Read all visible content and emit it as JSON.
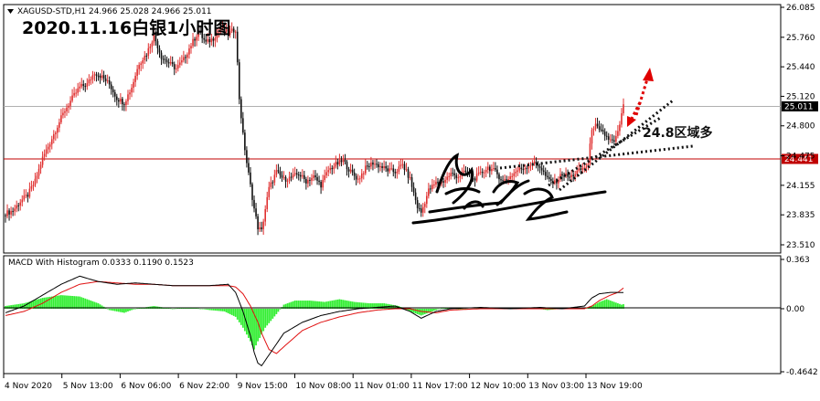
{
  "header": {
    "symbol_line": "XAGUSD-STD,H1  24.966 25.028 24.966 25.011",
    "headline": "2020.11.16白银1小时图"
  },
  "annotation": {
    "zone_text": "24.8区域多"
  },
  "indicator": {
    "label": "MACD With Histogram 0.0333 0.1190 0.1523"
  },
  "colors": {
    "bull_candle": "#e03030",
    "bear_candle": "#101010",
    "histogram": "#33ee33",
    "macd_line": "#000000",
    "signal_line": "#e01010",
    "hline": "#c00000",
    "price_tag_bg": "#c00000",
    "arrow": "#e00000"
  },
  "chart_data": [
    {
      "type": "candlestick",
      "title": "XAGUSD-STD,H1",
      "ylim": [
        23.51,
        26.085
      ],
      "y_ticks": [
        "26.085",
        "25.760",
        "25.440",
        "25.120",
        "24.800",
        "24.475",
        "24.155",
        "23.835",
        "23.510"
      ],
      "x_ticks": [
        "4 Nov 2020",
        "5 Nov 13:00",
        "6 Nov 06:00",
        "6 Nov 22:00",
        "9 Nov 15:00",
        "10 Nov 08:00",
        "11 Nov 01:00",
        "11 Nov 17:00",
        "12 Nov 10:00",
        "13 Nov 03:00",
        "13 Nov 19:00"
      ],
      "last_price": 25.011,
      "last_price_label": "25.011",
      "hline_value": 24.441,
      "hline_label": "24.441",
      "close_anchors": [
        [
          0,
          23.85
        ],
        [
          4,
          23.88
        ],
        [
          8,
          23.98
        ],
        [
          12,
          24.05
        ],
        [
          16,
          24.2
        ],
        [
          20,
          24.45
        ],
        [
          24,
          24.62
        ],
        [
          28,
          24.8
        ],
        [
          32,
          24.97
        ],
        [
          36,
          25.1
        ],
        [
          40,
          25.22
        ],
        [
          44,
          25.25
        ],
        [
          48,
          25.38
        ],
        [
          52,
          25.33
        ],
        [
          56,
          25.25
        ],
        [
          60,
          25.1
        ],
        [
          64,
          25.05
        ],
        [
          68,
          25.22
        ],
        [
          72,
          25.48
        ],
        [
          76,
          25.58
        ],
        [
          80,
          25.78
        ],
        [
          84,
          25.55
        ],
        [
          88,
          25.48
        ],
        [
          92,
          25.42
        ],
        [
          96,
          25.52
        ],
        [
          100,
          25.68
        ],
        [
          104,
          25.82
        ],
        [
          108,
          25.7
        ],
        [
          112,
          25.75
        ],
        [
          116,
          25.86
        ],
        [
          120,
          25.8
        ],
        [
          124,
          25.85
        ],
        [
          126,
          25.1
        ],
        [
          128,
          24.7
        ],
        [
          130,
          24.4
        ],
        [
          132,
          24.15
        ],
        [
          134,
          23.9
        ],
        [
          136,
          23.7
        ],
        [
          138,
          23.66
        ],
        [
          140,
          23.9
        ],
        [
          142,
          24.12
        ],
        [
          146,
          24.3
        ],
        [
          150,
          24.22
        ],
        [
          154,
          24.24
        ],
        [
          158,
          24.28
        ],
        [
          162,
          24.2
        ],
        [
          166,
          24.25
        ],
        [
          170,
          24.16
        ],
        [
          174,
          24.32
        ],
        [
          178,
          24.38
        ],
        [
          182,
          24.42
        ],
        [
          186,
          24.3
        ],
        [
          190,
          24.22
        ],
        [
          194,
          24.34
        ],
        [
          198,
          24.4
        ],
        [
          202,
          24.36
        ],
        [
          206,
          24.32
        ],
        [
          210,
          24.3
        ],
        [
          214,
          24.38
        ],
        [
          218,
          24.22
        ],
        [
          222,
          23.92
        ],
        [
          224,
          23.86
        ],
        [
          228,
          24.1
        ],
        [
          232,
          24.18
        ],
        [
          236,
          24.2
        ],
        [
          240,
          24.28
        ],
        [
          244,
          24.25
        ],
        [
          248,
          24.3
        ],
        [
          252,
          24.22
        ],
        [
          256,
          24.28
        ],
        [
          260,
          24.35
        ],
        [
          264,
          24.3
        ],
        [
          268,
          24.2
        ],
        [
          272,
          24.25
        ],
        [
          276,
          24.32
        ],
        [
          280,
          24.35
        ],
        [
          284,
          24.4
        ],
        [
          288,
          24.36
        ],
        [
          292,
          24.22
        ],
        [
          296,
          24.18
        ],
        [
          300,
          24.28
        ],
        [
          304,
          24.24
        ],
        [
          308,
          24.3
        ],
        [
          312,
          24.35
        ],
        [
          314,
          24.38
        ],
        [
          316,
          24.78
        ],
        [
          318,
          24.8
        ],
        [
          320,
          24.74
        ],
        [
          322,
          24.72
        ],
        [
          324,
          24.68
        ],
        [
          326,
          24.64
        ],
        [
          328,
          24.62
        ],
        [
          330,
          24.72
        ],
        [
          332,
          24.92
        ],
        [
          333,
          25.011
        ]
      ]
    },
    {
      "type": "macd",
      "title": "MACD With Histogram",
      "values": {
        "histogram": 0.0333,
        "macd": 0.119,
        "signal": 0.1523
      },
      "ylim": [
        -0.4642,
        0.363
      ],
      "y_ticks": [
        "0.363",
        "0.00",
        "-0.4642"
      ],
      "hist_anchors": [
        [
          0,
          0.02
        ],
        [
          10,
          0.04
        ],
        [
          20,
          0.08
        ],
        [
          30,
          0.1
        ],
        [
          40,
          0.09
        ],
        [
          50,
          0.04
        ],
        [
          56,
          -0.01
        ],
        [
          64,
          -0.03
        ],
        [
          70,
          0.0
        ],
        [
          80,
          0.02
        ],
        [
          90,
          0.0
        ],
        [
          100,
          0.01
        ],
        [
          110,
          -0.01
        ],
        [
          118,
          -0.02
        ],
        [
          124,
          -0.06
        ],
        [
          128,
          -0.14
        ],
        [
          132,
          -0.24
        ],
        [
          134,
          -0.3
        ],
        [
          136,
          -0.24
        ],
        [
          140,
          -0.14
        ],
        [
          146,
          -0.04
        ],
        [
          150,
          0.03
        ],
        [
          156,
          0.06
        ],
        [
          164,
          0.06
        ],
        [
          172,
          0.05
        ],
        [
          180,
          0.07
        ],
        [
          188,
          0.05
        ],
        [
          196,
          0.04
        ],
        [
          204,
          0.04
        ],
        [
          212,
          0.02
        ],
        [
          218,
          -0.02
        ],
        [
          224,
          -0.05
        ],
        [
          230,
          -0.02
        ],
        [
          236,
          0.01
        ],
        [
          244,
          0.0
        ],
        [
          252,
          0.0
        ],
        [
          262,
          0.01
        ],
        [
          272,
          0.0
        ],
        [
          282,
          0.01
        ],
        [
          292,
          -0.01
        ],
        [
          300,
          0.0
        ],
        [
          310,
          0.0
        ],
        [
          316,
          0.02
        ],
        [
          320,
          0.05
        ],
        [
          324,
          0.07
        ],
        [
          328,
          0.05
        ],
        [
          332,
          0.03
        ],
        [
          333,
          0.0333
        ]
      ],
      "macd_anchors": [
        [
          0,
          -0.03
        ],
        [
          10,
          0.02
        ],
        [
          20,
          0.1
        ],
        [
          30,
          0.18
        ],
        [
          40,
          0.24
        ],
        [
          50,
          0.2
        ],
        [
          60,
          0.18
        ],
        [
          70,
          0.19
        ],
        [
          80,
          0.18
        ],
        [
          90,
          0.17
        ],
        [
          100,
          0.17
        ],
        [
          110,
          0.17
        ],
        [
          120,
          0.18
        ],
        [
          124,
          0.12
        ],
        [
          128,
          -0.02
        ],
        [
          132,
          -0.2
        ],
        [
          134,
          -0.32
        ],
        [
          136,
          -0.4
        ],
        [
          138,
          -0.42
        ],
        [
          142,
          -0.34
        ],
        [
          146,
          -0.26
        ],
        [
          150,
          -0.18
        ],
        [
          160,
          -0.1
        ],
        [
          170,
          -0.05
        ],
        [
          180,
          -0.02
        ],
        [
          190,
          0.0
        ],
        [
          200,
          0.01
        ],
        [
          210,
          0.02
        ],
        [
          218,
          -0.02
        ],
        [
          224,
          -0.07
        ],
        [
          232,
          -0.02
        ],
        [
          240,
          0.0
        ],
        [
          256,
          0.01
        ],
        [
          272,
          0.0
        ],
        [
          288,
          0.01
        ],
        [
          300,
          0.0
        ],
        [
          312,
          0.02
        ],
        [
          316,
          0.08
        ],
        [
          320,
          0.11
        ],
        [
          326,
          0.12
        ],
        [
          330,
          0.12
        ],
        [
          333,
          0.119
        ]
      ],
      "signal_anchors": [
        [
          0,
          -0.05
        ],
        [
          10,
          -0.02
        ],
        [
          20,
          0.04
        ],
        [
          30,
          0.12
        ],
        [
          40,
          0.18
        ],
        [
          50,
          0.2
        ],
        [
          60,
          0.19
        ],
        [
          70,
          0.18
        ],
        [
          80,
          0.18
        ],
        [
          90,
          0.17
        ],
        [
          100,
          0.17
        ],
        [
          110,
          0.17
        ],
        [
          120,
          0.17
        ],
        [
          124,
          0.16
        ],
        [
          128,
          0.11
        ],
        [
          132,
          0.02
        ],
        [
          136,
          -0.1
        ],
        [
          138,
          -0.18
        ],
        [
          142,
          -0.3
        ],
        [
          146,
          -0.33
        ],
        [
          150,
          -0.28
        ],
        [
          160,
          -0.16
        ],
        [
          170,
          -0.1
        ],
        [
          180,
          -0.06
        ],
        [
          190,
          -0.03
        ],
        [
          200,
          -0.01
        ],
        [
          210,
          0.0
        ],
        [
          218,
          0.0
        ],
        [
          224,
          -0.02
        ],
        [
          232,
          -0.03
        ],
        [
          240,
          -0.01
        ],
        [
          256,
          0.0
        ],
        [
          272,
          0.0
        ],
        [
          288,
          0.0
        ],
        [
          300,
          0.0
        ],
        [
          312,
          0.0
        ],
        [
          316,
          0.02
        ],
        [
          320,
          0.06
        ],
        [
          326,
          0.1
        ],
        [
          330,
          0.12
        ],
        [
          333,
          0.1523
        ]
      ]
    }
  ]
}
